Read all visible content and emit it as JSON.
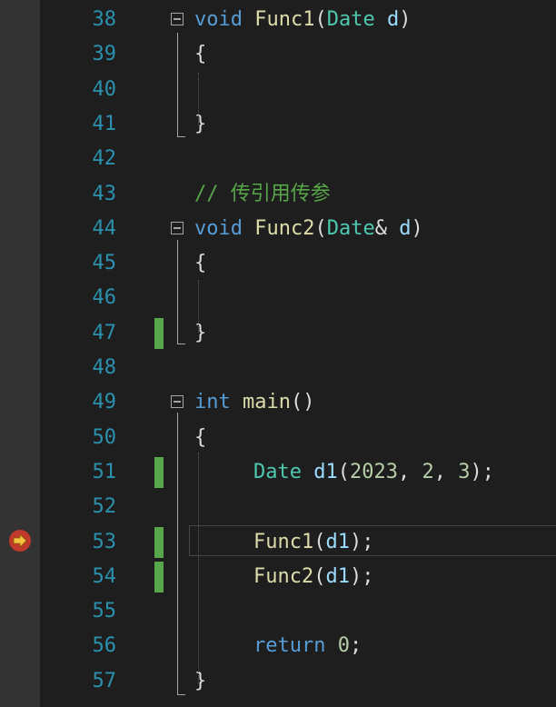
{
  "editor": {
    "lines": [
      {
        "num": "38",
        "tokens": [
          {
            "t": "void",
            "c": "kw"
          },
          {
            "t": " ",
            "c": "pl"
          },
          {
            "t": "Func1",
            "c": "fn"
          },
          {
            "t": "(",
            "c": "pl"
          },
          {
            "t": "Date",
            "c": "ty"
          },
          {
            "t": " ",
            "c": "pl"
          },
          {
            "t": "d",
            "c": "pa"
          },
          {
            "t": ")",
            "c": "pl"
          }
        ]
      },
      {
        "num": "39",
        "tokens": [
          {
            "t": "{",
            "c": "pl"
          }
        ]
      },
      {
        "num": "40",
        "tokens": []
      },
      {
        "num": "41",
        "tokens": [
          {
            "t": "}",
            "c": "pl"
          }
        ]
      },
      {
        "num": "42",
        "tokens": []
      },
      {
        "num": "43",
        "tokens": [
          {
            "t": "// 传引用传参",
            "c": "cm"
          }
        ]
      },
      {
        "num": "44",
        "tokens": [
          {
            "t": "void",
            "c": "kw"
          },
          {
            "t": " ",
            "c": "pl"
          },
          {
            "t": "Func2",
            "c": "fn"
          },
          {
            "t": "(",
            "c": "pl"
          },
          {
            "t": "Date",
            "c": "ty"
          },
          {
            "t": "& ",
            "c": "pl"
          },
          {
            "t": "d",
            "c": "pa"
          },
          {
            "t": ")",
            "c": "pl"
          }
        ]
      },
      {
        "num": "45",
        "tokens": [
          {
            "t": "{",
            "c": "pl"
          }
        ]
      },
      {
        "num": "46",
        "tokens": []
      },
      {
        "num": "47",
        "tokens": [
          {
            "t": "}",
            "c": "pl"
          }
        ]
      },
      {
        "num": "48",
        "tokens": []
      },
      {
        "num": "49",
        "tokens": [
          {
            "t": "int",
            "c": "kw"
          },
          {
            "t": " ",
            "c": "pl"
          },
          {
            "t": "main",
            "c": "fn"
          },
          {
            "t": "()",
            "c": "pl"
          }
        ]
      },
      {
        "num": "50",
        "tokens": [
          {
            "t": "{",
            "c": "pl"
          }
        ]
      },
      {
        "num": "51",
        "tokens": [
          {
            "t": "Date",
            "c": "ty"
          },
          {
            "t": " ",
            "c": "pl"
          },
          {
            "t": "d1",
            "c": "pa"
          },
          {
            "t": "(",
            "c": "pl"
          },
          {
            "t": "2023",
            "c": "nm"
          },
          {
            "t": ", ",
            "c": "pl"
          },
          {
            "t": "2",
            "c": "nm"
          },
          {
            "t": ", ",
            "c": "pl"
          },
          {
            "t": "3",
            "c": "nm"
          },
          {
            "t": ");",
            "c": "pl"
          }
        ]
      },
      {
        "num": "52",
        "tokens": []
      },
      {
        "num": "53",
        "tokens": [
          {
            "t": "Func1",
            "c": "fn"
          },
          {
            "t": "(",
            "c": "pl"
          },
          {
            "t": "d1",
            "c": "pa"
          },
          {
            "t": ");",
            "c": "pl"
          }
        ]
      },
      {
        "num": "54",
        "tokens": [
          {
            "t": "Func2",
            "c": "fn"
          },
          {
            "t": "(",
            "c": "pl"
          },
          {
            "t": "d1",
            "c": "pa"
          },
          {
            "t": ");",
            "c": "pl"
          }
        ]
      },
      {
        "num": "55",
        "tokens": []
      },
      {
        "num": "56",
        "tokens": [
          {
            "t": "return",
            "c": "kw"
          },
          {
            "t": " ",
            "c": "pl"
          },
          {
            "t": "0",
            "c": "nm"
          },
          {
            "t": ";",
            "c": "pl"
          }
        ]
      },
      {
        "num": "57",
        "tokens": [
          {
            "t": "}",
            "c": "pl"
          }
        ]
      }
    ],
    "current_line": "53",
    "colors": {
      "background": "#1e1e1e",
      "margin": "#333333",
      "line_number": "#2b91af",
      "keyword": "#569cd6",
      "function": "#dcdcaa",
      "type": "#4ec9b0",
      "parameter": "#9cdcfe",
      "number": "#b5cea8",
      "comment": "#57a64a",
      "change_marker": "#57a64a",
      "breakpoint_arrow": "#e8a33d"
    },
    "icons": {
      "breakpoint": "breakpoint-current-statement-icon",
      "collapse": "collapse-minus-icon"
    }
  }
}
